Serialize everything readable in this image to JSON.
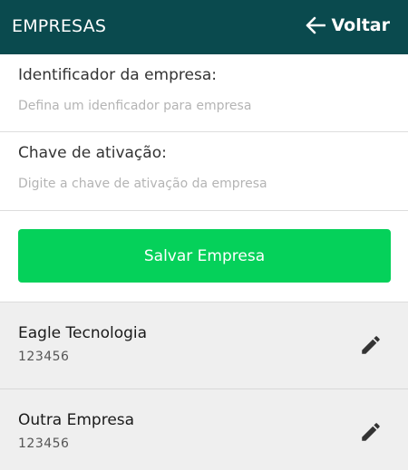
{
  "header": {
    "title": "EMPRESAS",
    "back_label": "Voltar",
    "back_icon": "arrow-left-icon",
    "color": "#0a4a4e"
  },
  "form": {
    "company_id": {
      "label": "Identificador da empresa:",
      "placeholder": "Defina um idenficador para empresa",
      "value": ""
    },
    "activation_key": {
      "label": "Chave de ativação:",
      "placeholder": "Digite a chave de ativação da empresa",
      "value": ""
    },
    "save_label": "Salvar Empresa",
    "save_color": "#05d15a"
  },
  "companies": [
    {
      "name": "Eagle Tecnologia",
      "code": "123456",
      "action_icon": "pencil-edit-icon"
    },
    {
      "name": "Outra Empresa",
      "code": "123456",
      "action_icon": "pencil-edit-icon"
    }
  ]
}
